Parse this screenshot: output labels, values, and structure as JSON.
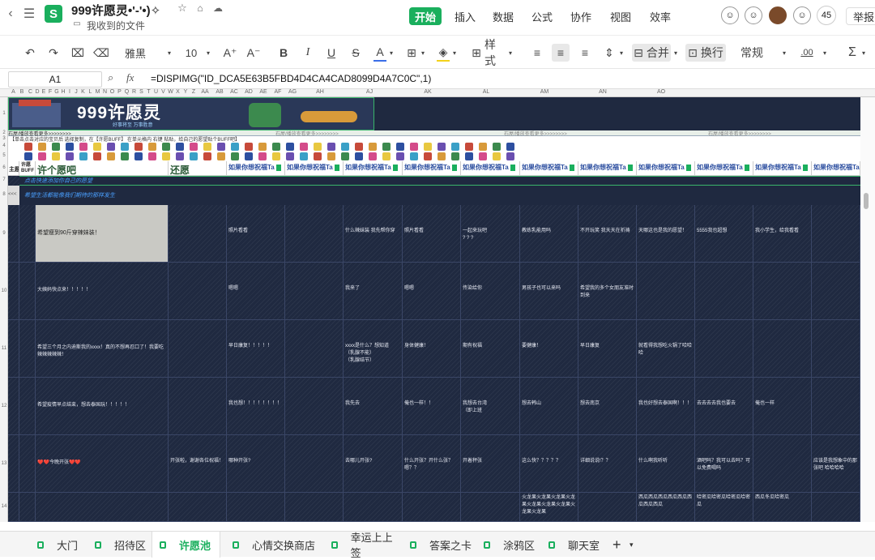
{
  "title": {
    "doc_name": "999许愿灵•'-'•)✧",
    "location": "我收到的文件",
    "logo_letter": "S"
  },
  "menu": [
    "开始",
    "插入",
    "数据",
    "公式",
    "协作",
    "视图",
    "效率"
  ],
  "collaborators": {
    "count": "45",
    "report": "举报"
  },
  "toolbar": {
    "font": "雅黑",
    "size": "10",
    "font_up": "A⁺",
    "font_down": "A⁻",
    "bold": "B",
    "italic": "I",
    "underline": "U",
    "strike": "S",
    "color_a": "A",
    "style": "样式",
    "merge": "合并",
    "wrap": "换行",
    "format": "常规",
    "decimal": ".00",
    "sum": "Σ"
  },
  "formula_bar": {
    "cell": "A1",
    "value": "=DISPIMG(\"ID_DCA5E63B5FBD4D4CA4CAD8099D4A7C0C\",1)"
  },
  "columns": [
    "A",
    "B",
    "C",
    "D",
    "E",
    "F",
    "G",
    "H",
    "I",
    "J",
    "K",
    "L",
    "M",
    "N",
    "O",
    "P",
    "Q",
    "R",
    "S",
    "T",
    "U",
    "V",
    "W",
    "X",
    "Y",
    "Z",
    "AA",
    "AB",
    "AC",
    "AD",
    "AE",
    "AF",
    "AG",
    "AH",
    "AJ",
    "AK",
    "AL",
    "AM",
    "AN",
    "AO"
  ],
  "rows": [
    "1",
    "2",
    "3",
    "4",
    "5",
    "6",
    "7",
    "8",
    "9",
    "10",
    "11",
    "12",
    "13",
    "14"
  ],
  "banner": {
    "title": "999许愿灵",
    "subtitle": "好事将至 万事胜意",
    "side": "999许愿灵"
  },
  "strip_text": "石屋/播放查看更多>>>>>>>>",
  "strip_repeat": "石屋/播放查看更多>>>>>>>>",
  "hint": "【单击点击对应的宝贝后 选择复制，在【许愿BUFF】 在单元格内 右键 粘贴，给自己的愿望贴个BUFF吧】",
  "headers": {
    "topic": "主题",
    "buff": "许愿BUFF",
    "wish": "许个愿吧",
    "fulfill": "还愿",
    "bless": "如果你想祝福Ta"
  },
  "band7": "点击快速添加你自己的愿望",
  "band8": "希望生活都能像我们期待的那样发生",
  "row8_left": "<<<",
  "rows_data": [
    {
      "wish": "希望瘦到90斤穿辣妹装！",
      "cells": [
        "",
        "照片看看",
        "",
        "什么辣妹装 我先帮你穿",
        "照片看看",
        "一起来玩吧\n? ? ?",
        "教练乳能用吗",
        "不开玩笑 我天天在祈祷",
        "天哪这也是我的愿望！",
        "5555我也超想",
        "我小学生，给我看看",
        ""
      ]
    },
    {
      "wish": "大姨妈快点来！！！！！",
      "cells": [
        "",
        "嗯嗯",
        "",
        "我来了",
        "嗯嗯",
        "传染给你",
        "男孩子也可以来吗",
        "希望我的多个女朋友准时到来",
        "",
        "",
        "",
        ""
      ]
    },
    {
      "wish": "希望三个月之内迪斯我的xxxx！真的不想再忍口了！我要吃辣辣辣辣辣！",
      "cells": [
        "",
        "早日康复！！！！！",
        "",
        "xxxx是什么？想知道\n（乳腺不能）\n（乳腺结节）",
        "身体健康！",
        "期有祝福",
        "要健康！",
        "早日康复",
        "就看得我想吃火锅了哈哈哈",
        "",
        "",
        ""
      ]
    },
    {
      "wish": "希望疫情早点结束，想去泰国玩！！！！！",
      "cells": [
        "",
        "我也想！！！！！！！！",
        "",
        "我先去",
        "俺也一样！！",
        "我想去台湾\n（即上班",
        "想去韩山",
        "想去南京",
        "我也好想去泰国啊！！！",
        "去去去去我也要去",
        "俺也一样",
        ""
      ]
    },
    {
      "wish": "❤️❤️今晚开张❤️❤️",
      "cells": [
        "开张啦，谢谢各位祝福！",
        "哪种开张?",
        "",
        "去哪儿开张?",
        "什么开张？开什么张？嗯？？",
        "开着秤张",
        "这么快？？？？？",
        "详细说说!？？",
        "什么啊我听听",
        "酒吧吗？我可以去吗？可以免费喝吗",
        "",
        "应该是我想象中的那张吧 哈哈哈哈"
      ]
    },
    {
      "wish": "",
      "cells": [
        "",
        "",
        "",
        "",
        "",
        "",
        "火龙果火龙果火龙果火龙果火龙果火龙果火龙果火龙果火龙果",
        "",
        "西瓜西瓜西瓜西瓜西瓜西瓜西瓜西瓜",
        "哈密瓜哈密瓜哈密瓜哈密瓜",
        "西瓜冬瓜哈密瓜",
        ""
      ]
    }
  ],
  "tabs": [
    "大门",
    "招待区",
    "许愿池",
    "心情交换商店",
    "幸运上上签",
    "答案之卡",
    "涂鸦区",
    "聊天室"
  ],
  "active_tab": "许愿池",
  "add_tab": "+",
  "colors": {
    "accent": "#1aaf5d",
    "sheet_bg": "#1f2940",
    "header_blue": "#2d4fa0"
  }
}
